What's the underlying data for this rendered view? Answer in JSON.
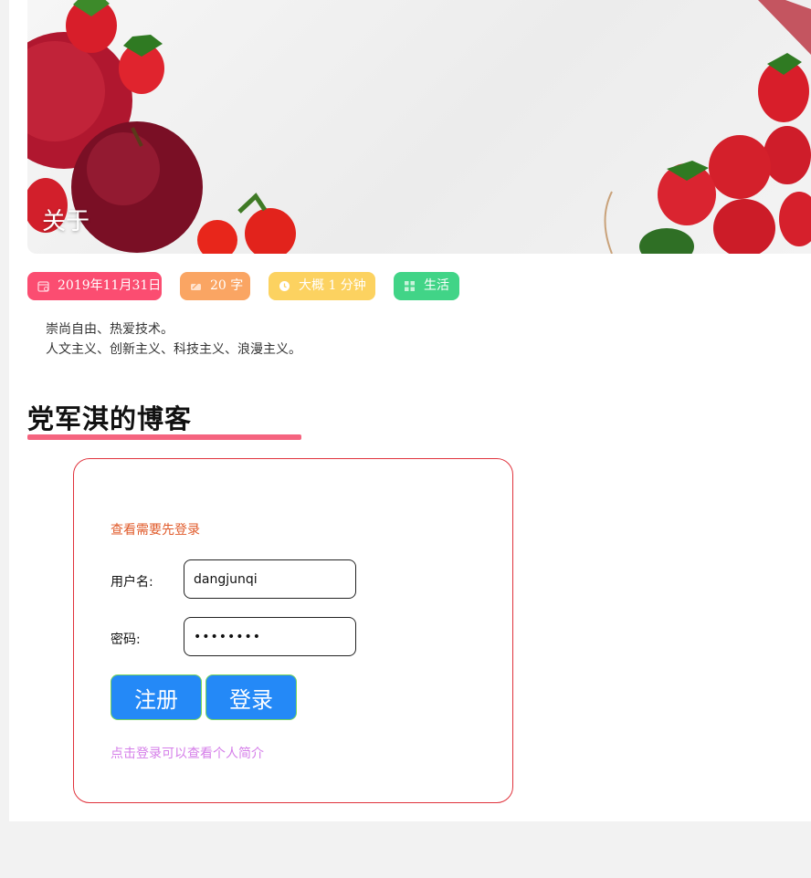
{
  "hero": {
    "title": "关于"
  },
  "meta": {
    "date": "2019年11月31日",
    "words": "20 字",
    "read_time": "大概 1 分钟",
    "category": "生活",
    "colors": {
      "date": "#fb4d71",
      "words": "#faa563",
      "time": "#fcd260",
      "category": "#41d487"
    }
  },
  "intro": {
    "line1": "崇尚自由、热爱技术。",
    "line2": "人文主义、创新主义、科技主义、浪漫主义。"
  },
  "blog": {
    "title": "党军淇的博客",
    "underline_color": "#f5647f"
  },
  "login": {
    "notice": "查看需要先登录",
    "username_label": "用户名:",
    "username_value": "dangjunqi",
    "password_label": "密码:",
    "password_value": "dangjunq",
    "register_button": "注册",
    "login_button": "登录",
    "hint_link": "点击登录可以查看个人简介",
    "border_color": "#e0323c",
    "button_color": "#2489f7"
  }
}
